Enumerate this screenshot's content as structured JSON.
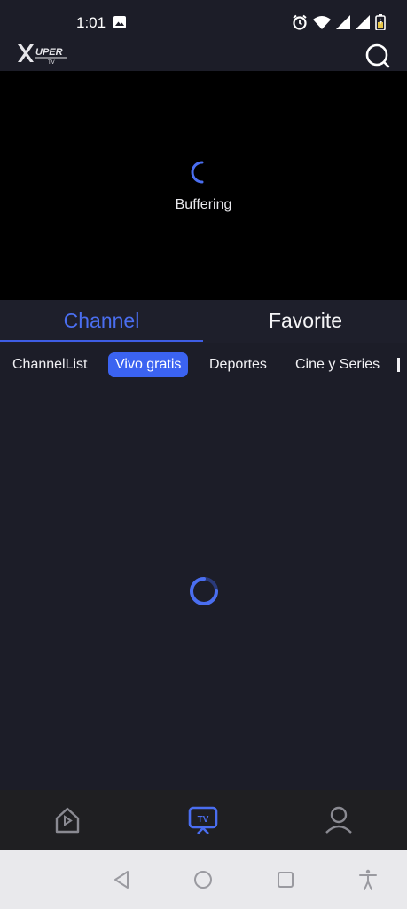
{
  "status_bar": {
    "time": "1:01",
    "icons": [
      "image-icon",
      "alarm-icon",
      "wifi-icon",
      "signal-icon",
      "signal-icon",
      "battery-icon"
    ]
  },
  "app_bar": {
    "logo_text": "XUPER",
    "logo_subtext": "TV",
    "search_icon": "search-icon"
  },
  "player": {
    "status_text": "Buffering",
    "accent_color": "#4a6ef0"
  },
  "tabs": [
    {
      "label": "Channel",
      "active": true
    },
    {
      "label": "Favorite",
      "active": false
    }
  ],
  "categories": [
    {
      "label": "ChannelList",
      "active": false
    },
    {
      "label": "Vivo gratis",
      "active": true
    },
    {
      "label": "Deportes",
      "active": false
    },
    {
      "label": "Cine y Series",
      "active": false
    }
  ],
  "bottom_nav": [
    {
      "icon": "home-icon",
      "active": false
    },
    {
      "icon": "tv-icon",
      "label": "TV",
      "active": true
    },
    {
      "icon": "profile-icon",
      "active": false
    }
  ],
  "system_nav": [
    "back-icon",
    "home-circle-icon",
    "recents-icon",
    "accessibility-icon"
  ],
  "colors": {
    "background": "#1c1d28",
    "accent": "#3b63f1",
    "bottom_nav_bg": "#1f1f22",
    "system_nav_bg": "#e9e9ec"
  }
}
